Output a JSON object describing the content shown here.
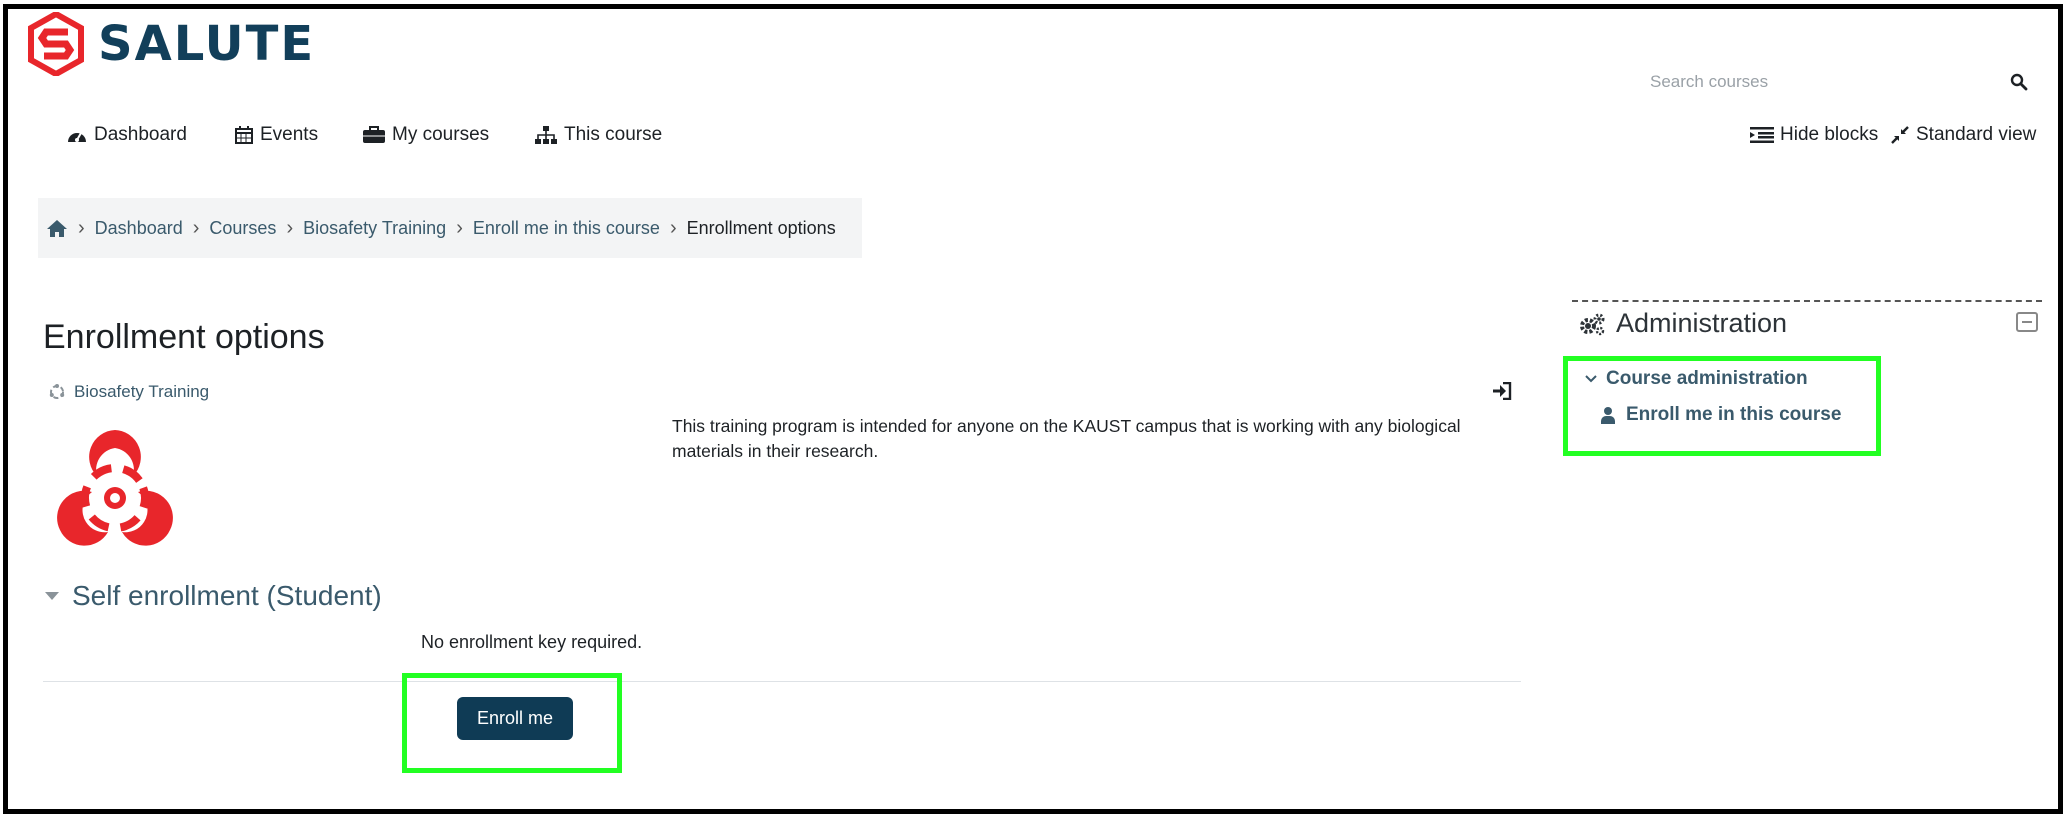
{
  "brand": {
    "name": "SALUTE",
    "logo_color": "#e8262b",
    "text_color": "#123f5a"
  },
  "search": {
    "placeholder": "Search courses",
    "icon": "search-icon"
  },
  "nav": {
    "items": [
      {
        "label": "Dashboard",
        "icon": "dashboard-icon"
      },
      {
        "label": "Events",
        "icon": "calendar-icon"
      },
      {
        "label": "My courses",
        "icon": "briefcase-icon"
      },
      {
        "label": "This course",
        "icon": "sitemap-icon"
      }
    ],
    "right": [
      {
        "label": "Hide blocks",
        "icon": "hide-blocks-icon"
      },
      {
        "label": "Standard view",
        "icon": "compress-icon"
      }
    ]
  },
  "breadcrumb": {
    "home_icon": "home-icon",
    "items": [
      "Dashboard",
      "Courses",
      "Biosafety Training",
      "Enroll me in this course",
      "Enrollment options"
    ]
  },
  "page": {
    "title": "Enrollment options",
    "course_name": "Biosafety Training",
    "description": "This training program is intended for anyone on the KAUST campus that is working with any biological materials in their research.",
    "self_enrollment_heading": "Self enrollment (Student)",
    "no_key_text": "No enrollment key required.",
    "enroll_button": "Enroll me"
  },
  "admin": {
    "title": "Administration",
    "course_admin": "Course administration",
    "enroll_link": "Enroll me in this course"
  },
  "colors": {
    "highlight": "#22ff22",
    "button_bg": "#0f3b55",
    "link": "#3a5a6c",
    "biohazard": "#e8262b"
  }
}
